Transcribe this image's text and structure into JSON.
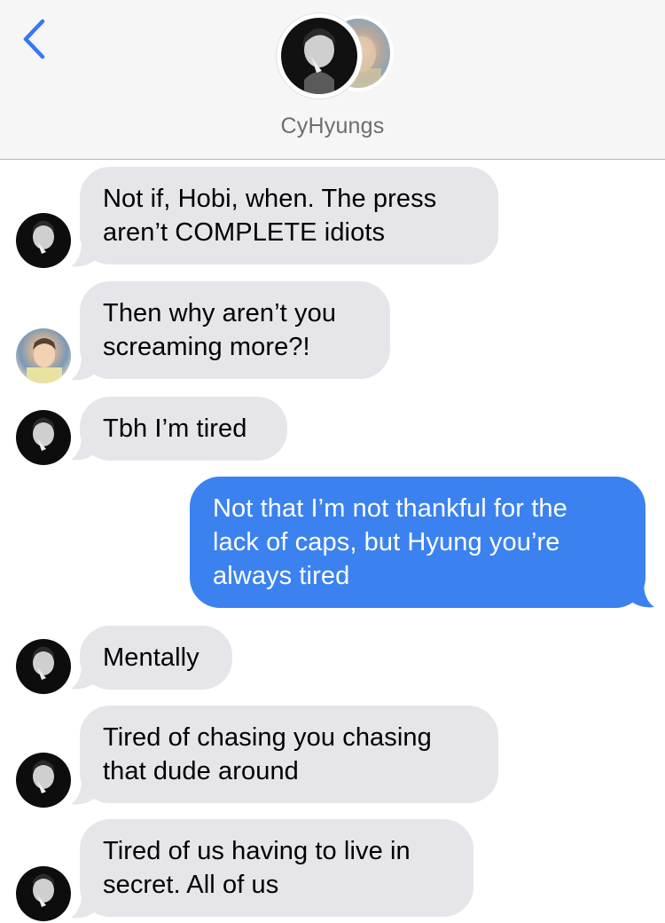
{
  "header": {
    "title": "CyHyungs",
    "back_icon": "chevron-left-icon",
    "accent_color": "#3478f6"
  },
  "messages": [
    {
      "direction": "incoming",
      "sender_avatar": "dark-avatar",
      "text": "Not if, Hobi, when. The press\naren’t COMPLETE idiots"
    },
    {
      "direction": "incoming",
      "sender_avatar": "light-avatar",
      "text": "Then why aren’t you\nscreaming more?!"
    },
    {
      "direction": "incoming",
      "sender_avatar": "dark-avatar",
      "text": "Tbh I’m tired"
    },
    {
      "direction": "outgoing",
      "text": "Not that I’m not thankful for the\nlack of caps, but Hyung you’re\nalways tired"
    },
    {
      "direction": "incoming",
      "sender_avatar": "dark-avatar",
      "text": "Mentally"
    },
    {
      "direction": "incoming",
      "sender_avatar": "dark-avatar",
      "text": "Tired of chasing you chasing\nthat dude around"
    },
    {
      "direction": "incoming",
      "sender_avatar": "dark-avatar",
      "text": "Tired of us having to live in\nsecret. All of us"
    }
  ],
  "colors": {
    "incoming_bubble": "#e5e5ea",
    "outgoing_bubble": "#3b82f0"
  }
}
